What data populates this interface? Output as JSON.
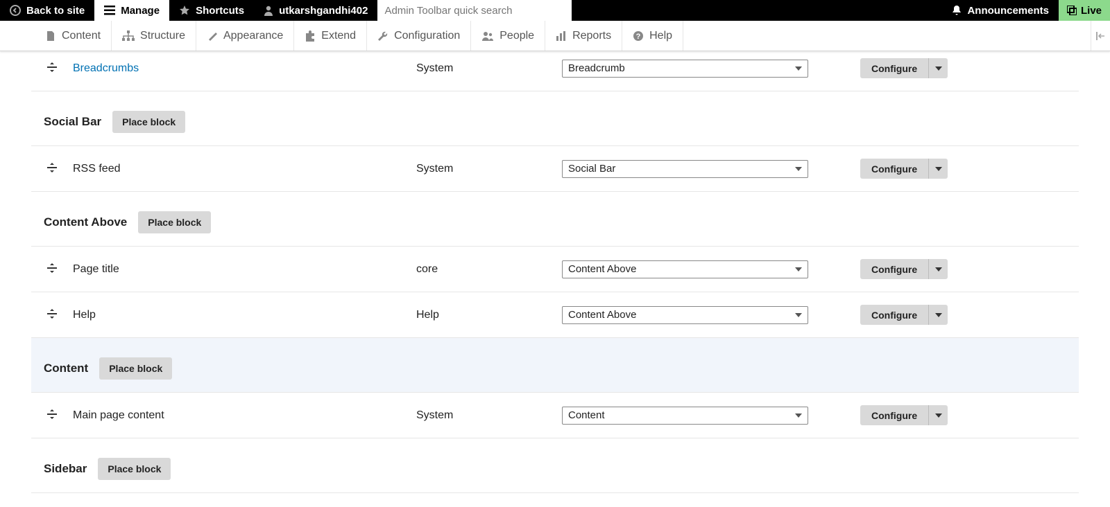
{
  "toolbar": {
    "back": "Back to site",
    "manage": "Manage",
    "shortcuts": "Shortcuts",
    "user": "utkarshgandhi402",
    "search_placeholder": "Admin Toolbar quick search",
    "announcements": "Announcements",
    "live": "Live"
  },
  "adminMenu": {
    "content": "Content",
    "structure": "Structure",
    "appearance": "Appearance",
    "extend": "Extend",
    "configuration": "Configuration",
    "people": "People",
    "reports": "Reports",
    "help": "Help"
  },
  "labels": {
    "place_block": "Place block",
    "configure": "Configure"
  },
  "rows": [
    {
      "name": "Breadcrumbs",
      "link": true,
      "category": "System",
      "region": "Breadcrumb"
    }
  ],
  "regions": [
    {
      "title": "Social Bar",
      "highlight": false,
      "blocks": [
        {
          "name": "RSS feed",
          "link": false,
          "category": "System",
          "region": "Social Bar"
        }
      ]
    },
    {
      "title": "Content Above",
      "highlight": false,
      "blocks": [
        {
          "name": "Page title",
          "link": false,
          "category": "core",
          "region": "Content Above"
        },
        {
          "name": "Help",
          "link": false,
          "category": "Help",
          "region": "Content Above"
        }
      ]
    },
    {
      "title": "Content",
      "highlight": true,
      "blocks": [
        {
          "name": "Main page content",
          "link": false,
          "category": "System",
          "region": "Content"
        }
      ]
    },
    {
      "title": "Sidebar",
      "highlight": false,
      "blocks": []
    }
  ]
}
